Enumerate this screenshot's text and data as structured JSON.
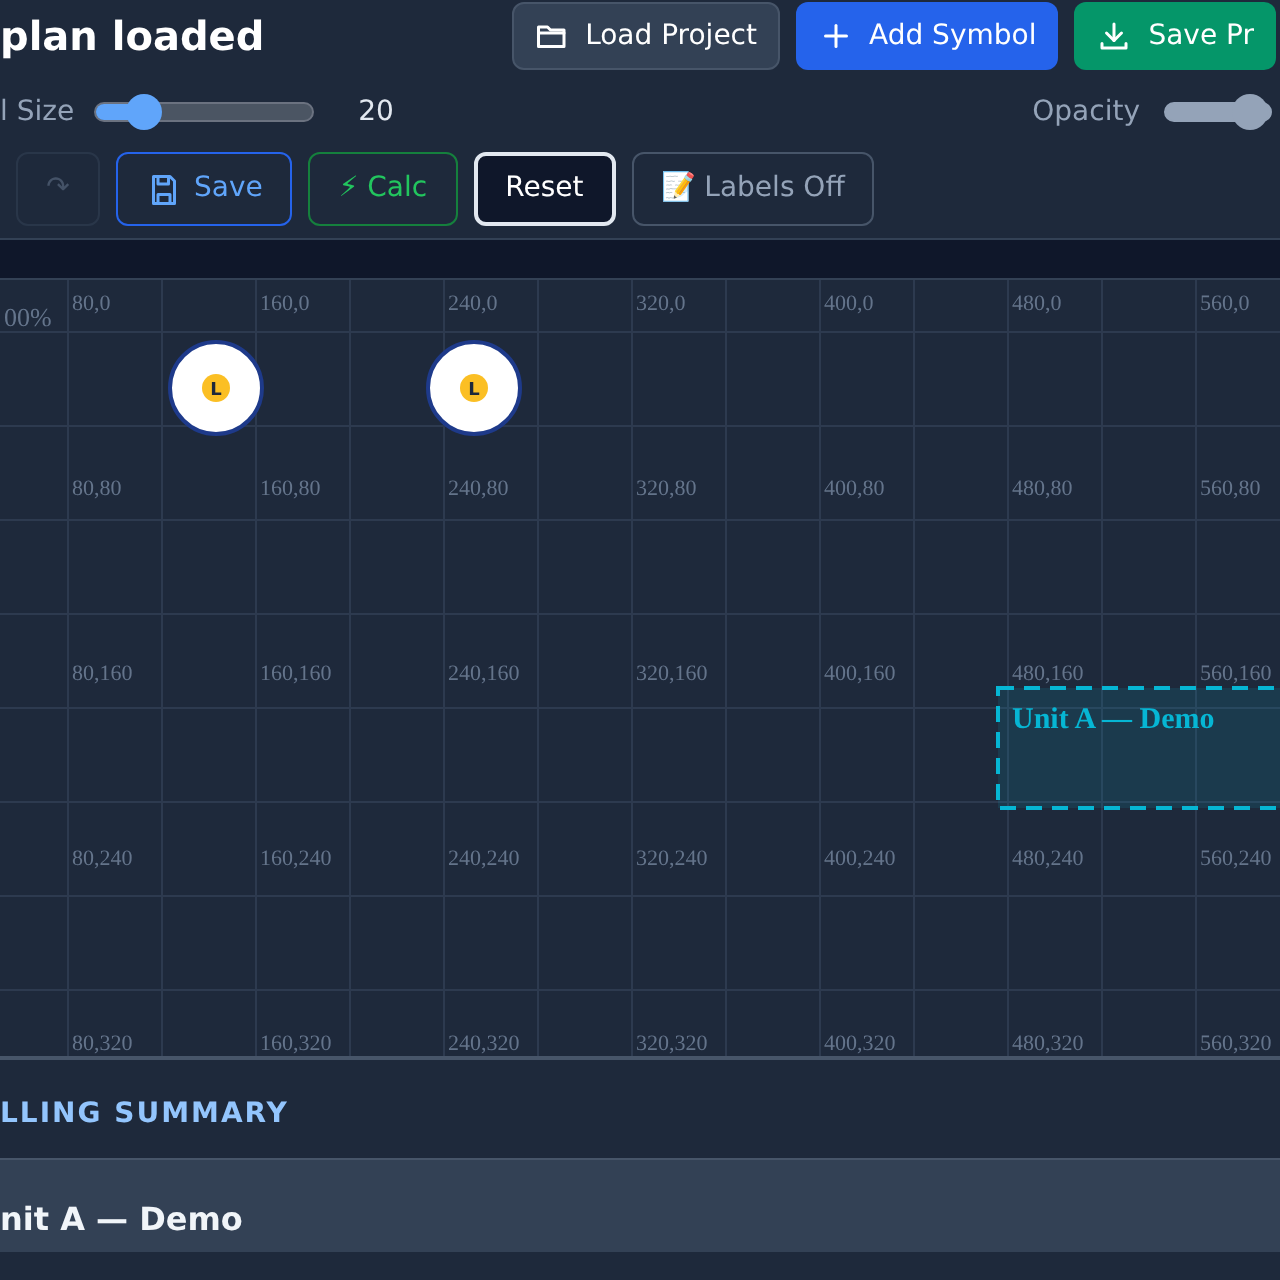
{
  "header": {
    "title": "plan loaded",
    "buttons": [
      {
        "kind": "load",
        "label": "Load Project"
      },
      {
        "kind": "add",
        "label": "Add Symbol"
      },
      {
        "kind": "save",
        "label": "Save Pr"
      }
    ]
  },
  "controls": {
    "size": {
      "label": "l Size",
      "level": 0.22,
      "reading": "20"
    },
    "opacity": {
      "label": "Opacity",
      "level": 0.8
    }
  },
  "toolbar": [
    {
      "kind": "redo",
      "label": "↷",
      "disabled": true
    },
    {
      "kind": "save",
      "label": "Save"
    },
    {
      "kind": "calc",
      "label": "⚡ Calc"
    },
    {
      "kind": "reset",
      "label": "Reset"
    },
    {
      "kind": "labels",
      "label": "📝 Labels Off"
    }
  ],
  "canvas": {
    "zoom": "00%",
    "grid_labels": [
      [
        "80,0",
        "160,0",
        "240,0",
        "320,0",
        "400,0",
        "480,0",
        "560,0"
      ],
      [
        "80,80",
        "160,80",
        "240,80",
        "320,80",
        "400,80",
        "480,80",
        "560,80"
      ],
      [
        "80,160",
        "160,160",
        "240,160",
        "320,160",
        "400,160",
        "480,160",
        "560,160"
      ],
      [
        "80,240",
        "160,240",
        "240,240",
        "320,240",
        "400,240",
        "480,240",
        "560,240"
      ],
      [
        "80,320",
        "160,320",
        "240,320",
        "320,320",
        "400,320",
        "480,320",
        "560,320"
      ]
    ],
    "symbols": [
      {
        "letter": "L"
      },
      {
        "letter": "L"
      }
    ],
    "units": [
      {
        "label": "Unit A — Demo",
        "color": "#06b6d4"
      }
    ]
  },
  "summary": {
    "heading": "LLING SUMMARY",
    "units": [
      {
        "name": "nit A — Demo"
      }
    ]
  }
}
